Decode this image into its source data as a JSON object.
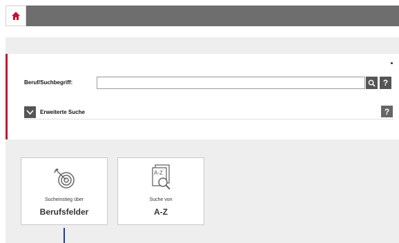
{
  "header": {
    "home_icon": "home-icon"
  },
  "search": {
    "label": "Beruf/Suchbegriff:",
    "input_value": "",
    "search_icon": "search-icon",
    "help_label": "?"
  },
  "advanced": {
    "label": "Erweiterte Suche",
    "toggle_icon": "chevron-down-icon",
    "help_label": "?"
  },
  "cards": [
    {
      "small": "Sucheinstieg über",
      "big": "Berufsfelder",
      "icon": "target-icon"
    },
    {
      "small": "Suche von",
      "big": "A-Z",
      "icon": "a-z-document-icon"
    }
  ],
  "colors": {
    "accent": "#c8102e",
    "topbar": "#6e6e6e",
    "button": "#555555"
  }
}
